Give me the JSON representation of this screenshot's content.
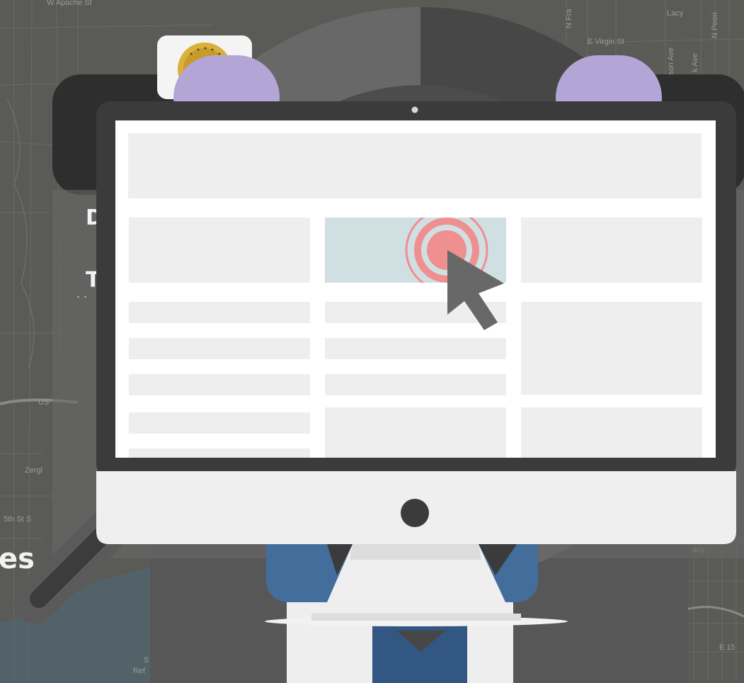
{
  "map": {
    "labels": {
      "apache": "W Apache St",
      "virgin": "E Virgin St",
      "lacy": "Lacy",
      "us": "US",
      "zerg": "Zergl",
      "fifth": "5th St S",
      "s": "S",
      "ref": "Ref",
      "fran": "N Fra",
      "peori": "N Peori",
      "sonave": "son Ave",
      "kave": "k Ave",
      "e15": "E 15",
      "lacy2": "acy"
    }
  },
  "page": {
    "heading_initial": "D",
    "subheading_initial": "T",
    "bottom_text": "es"
  },
  "colors": {
    "lens": "#686868",
    "lens_dark": "#474747",
    "monitor_bezel": "#3b3b3b",
    "monitor_chin": "#efefef",
    "screen": "#ffffff",
    "block": "#eeeeee",
    "highlight_block": "#d0dfe2",
    "target": "#ef8f8f",
    "cursor": "#686868",
    "headband": "#b3a6d6",
    "shirt": "#436d9b",
    "tie": "#325782"
  }
}
